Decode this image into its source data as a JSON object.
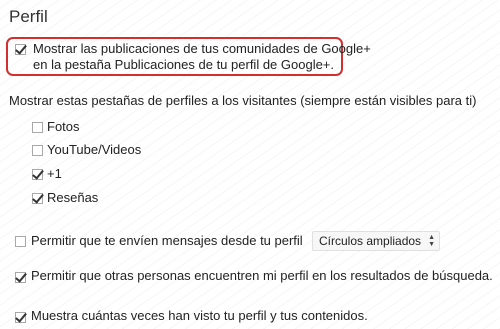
{
  "section_title": "Perfil",
  "communities": {
    "label_line1": "Mostrar las publicaciones de tus comunidades de Google+",
    "label_line2": "en la pestaña Publicaciones de tu perfil de Google+.",
    "checked": true
  },
  "tabs_heading": "Mostrar estas pestañas de perfiles a los visitantes (siempre están visibles para ti)",
  "tabs": [
    {
      "label": "Fotos",
      "checked": false
    },
    {
      "label": "YouTube/Videos",
      "checked": false
    },
    {
      "label": "+1",
      "checked": true
    },
    {
      "label": "Reseñas",
      "checked": true
    }
  ],
  "messages": {
    "label": "Permitir que te envíen mensajes desde tu perfil",
    "checked": false,
    "select_value": "Círculos ampliados"
  },
  "search": {
    "label": "Permitir que otras personas encuentren mi perfil en los resultados de búsqueda.",
    "checked": true
  },
  "views": {
    "label": "Muestra cuántas veces han visto tu perfil y tus contenidos.",
    "checked": true
  },
  "colors": {
    "highlight_border": "#d32f2f",
    "text": "#222222"
  }
}
